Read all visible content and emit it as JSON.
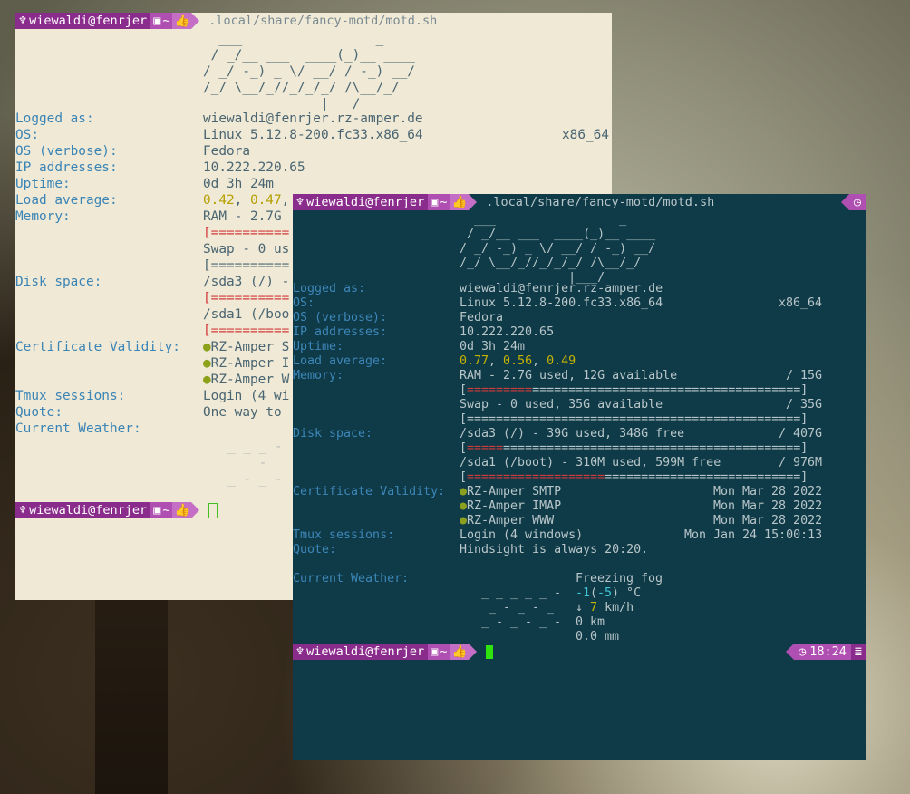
{
  "prompt": {
    "user_host": "wiewaldi@fenrjer",
    "dir": "~",
    "command": ".local/share/fancy-motd/motd.sh",
    "time": "18:24"
  },
  "icons": {
    "user": "person-icon",
    "save": "floppy-icon",
    "thumb": "thumbs-up-icon",
    "clock": "clock-icon",
    "db": "database-icon"
  },
  "ascii_banner": [
    "  ___                 _",
    " / _/__ ___  ____(_)__ ____",
    "/ _/ -_) _ \\/ __/ / -_) __/",
    "/_/ \\__/_//_/_/_/ /\\__/_/",
    "               |___/"
  ],
  "labels": {
    "logged_as": "Logged as:",
    "os": "OS:",
    "os_verbose": "OS (verbose):",
    "ip": "IP addresses:",
    "uptime": "Uptime:",
    "load": "Load average:",
    "memory": "Memory:",
    "disk": "Disk space:",
    "cert": "Certificate Validity:",
    "tmux": "Tmux sessions:",
    "quote": "Quote:",
    "weather": "Current Weather:"
  },
  "back_terminal": {
    "logged_as": "wiewaldi@fenrjer.rz-amper.de",
    "os": "Linux 5.12.8-200.fc33.x86_64",
    "arch": "x86_64",
    "os_verbose": "Fedora",
    "ip": "10.222.220.65",
    "uptime": "0d 3h 24m",
    "load_1": "0.42",
    "load_sep": ", ",
    "load_5": "0.47",
    "load_rest": ",",
    "memory": "RAM - 2.7G",
    "mem_bar": "[==========",
    "swap": "Swap - 0 us",
    "swap_bar": "[==========",
    "disk1": "/sda3 (/) -",
    "disk1_bar": "[==========",
    "disk2": "/sda1 (/boo",
    "disk2_bar": "[==========",
    "cert1": "RZ-Amper S",
    "cert2": "RZ-Amper I",
    "cert3": "RZ-Amper W",
    "tmux": "Login (4 wi",
    "quote": "One way to",
    "weather_art": [
      "_ _ _ -",
      "  _ - _",
      "_ - _ -"
    ]
  },
  "front_terminal": {
    "logged_as": "wiewaldi@fenrjer.rz-amper.de",
    "os": "Linux 5.12.8-200.fc33.x86_64",
    "arch": "x86_64",
    "os_verbose": "Fedora",
    "ip": "10.222.220.65",
    "uptime": "0d 3h 24m",
    "load_1": "0.77",
    "load_5": "0.56",
    "load_15": "0.49",
    "memory": "RAM - 2.7G used, 12G available",
    "memory_total": "/ 15G",
    "mem_bar_red": "",
    "mem_bar_rest": "[==============================================]",
    "swap": "Swap - 0 used, 35G available",
    "swap_total": "/ 35G",
    "swap_bar": "[==============================================]",
    "disk1": "/sda3 (/) - 39G used, 348G free",
    "disk1_total": "/ 407G",
    "disk1_bar_open": "[",
    "disk1_bar_red": "=====",
    "disk1_bar_rest": "=========================================]",
    "disk2": "/sda1 (/boot) - 310M used, 599M free",
    "disk2_total": "/ 976M",
    "disk2_bar_open": "[",
    "disk2_bar_red": "===================",
    "disk2_bar_rest": "===========================]",
    "certs": [
      {
        "name": "RZ-Amper SMTP",
        "date": "Mon Mar 28 2022"
      },
      {
        "name": "RZ-Amper IMAP",
        "date": "Mon Mar 28 2022"
      },
      {
        "name": "RZ-Amper WWW",
        "date": "Mon Mar 28 2022"
      }
    ],
    "tmux": "Login (4 windows)",
    "tmux_date": "Mon Jan 24 15:00:13",
    "quote": "Hindsight is always 20:20.",
    "weather": {
      "condition": "Freezing fog",
      "temp_a": "-1",
      "temp_open": "(",
      "temp_b": "-5",
      "temp_close": ") °C",
      "wind_arrow": "↓",
      "wind_speed": "7",
      "wind_unit": "km/h",
      "visibility": "0 km",
      "precip": "0.0 mm",
      "art": [
        "_ _ _ _ _ -",
        "_ - _ - _",
        "_ - _ - _ -"
      ]
    },
    "bullet": "●"
  }
}
